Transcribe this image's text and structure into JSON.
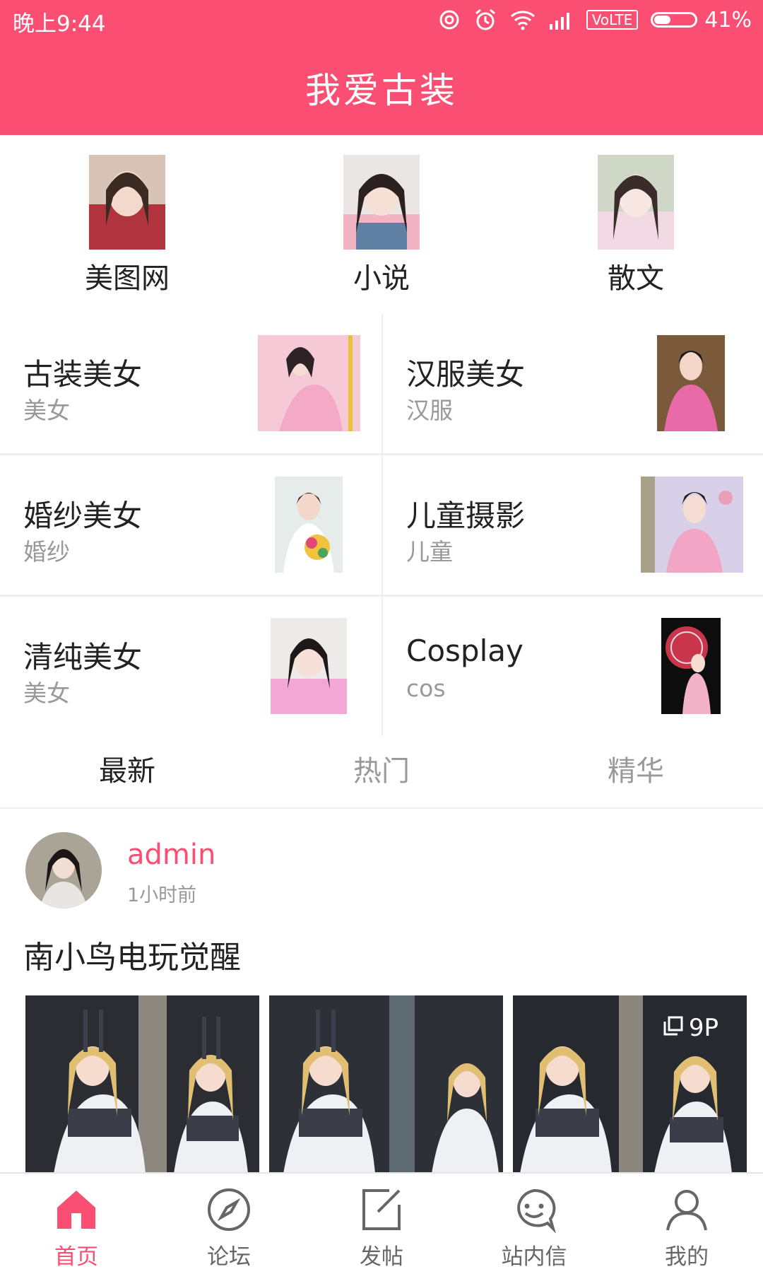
{
  "status_bar": {
    "time": "晚上9:44",
    "network_badge": "VoLTE",
    "battery_percent": "41%",
    "battery_level": 0.41
  },
  "header": {
    "title": "我爱古装"
  },
  "quick_entries": [
    {
      "label": "美图网",
      "icon": "portrait-photo"
    },
    {
      "label": "小说",
      "icon": "portrait-photo"
    },
    {
      "label": "散文",
      "icon": "portrait-photo"
    }
  ],
  "categories": [
    {
      "name": "古装美女",
      "sub": "美女"
    },
    {
      "name": "汉服美女",
      "sub": "汉服"
    },
    {
      "name": "婚纱美女",
      "sub": "婚纱"
    },
    {
      "name": "儿童摄影",
      "sub": "儿童"
    },
    {
      "name": "清纯美女",
      "sub": "美女"
    },
    {
      "name": "Cosplay",
      "sub": "cos"
    }
  ],
  "tabs": [
    {
      "label": "最新",
      "active": true
    },
    {
      "label": "热门",
      "active": false
    },
    {
      "label": "精华",
      "active": false
    }
  ],
  "post": {
    "username": "admin",
    "time": "1小时前",
    "title": "南小鸟电玩觉醒",
    "image_count": "9P"
  },
  "bottom_nav": [
    {
      "label": "首页",
      "icon": "home-icon",
      "active": true
    },
    {
      "label": "论坛",
      "icon": "compass-icon",
      "active": false
    },
    {
      "label": "发帖",
      "icon": "edit-icon",
      "active": false
    },
    {
      "label": "站内信",
      "icon": "message-icon",
      "active": false
    },
    {
      "label": "我的",
      "icon": "user-icon",
      "active": false
    }
  ],
  "colors": {
    "accent": "#fa4f73",
    "text_primary": "#222222",
    "text_secondary": "#999999",
    "divider": "#eeeeee"
  }
}
